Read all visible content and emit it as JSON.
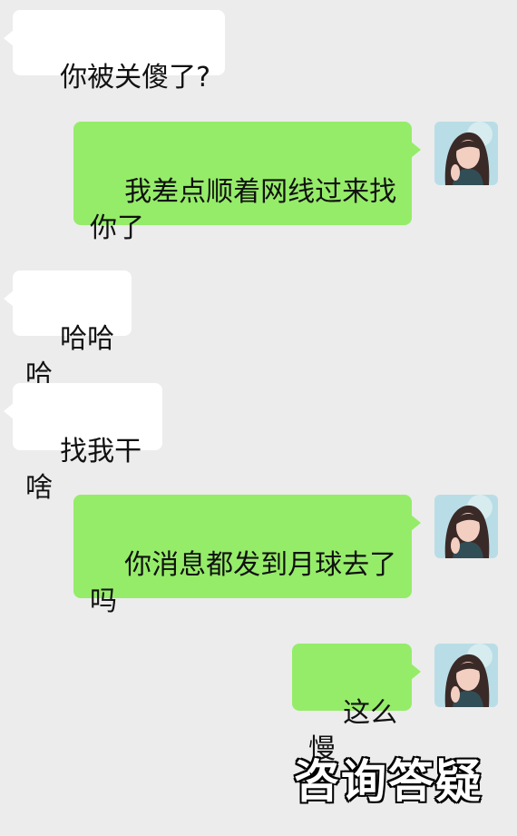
{
  "conversation": {
    "messages": [
      {
        "side": "left",
        "text": "你被关傻了?"
      },
      {
        "side": "right",
        "text": "我差点顺着网线过来找你了"
      },
      {
        "side": "left",
        "text": "哈哈哈"
      },
      {
        "side": "left",
        "text": "找我干啥"
      },
      {
        "side": "right",
        "text": "你消息都发到月球去了吗"
      },
      {
        "side": "right",
        "text": "这么慢"
      }
    ]
  },
  "overlay": {
    "caption": "咨询答疑"
  },
  "colors": {
    "background": "#ececec",
    "incoming_bubble": "#ffffff",
    "outgoing_bubble": "#95ec69"
  }
}
